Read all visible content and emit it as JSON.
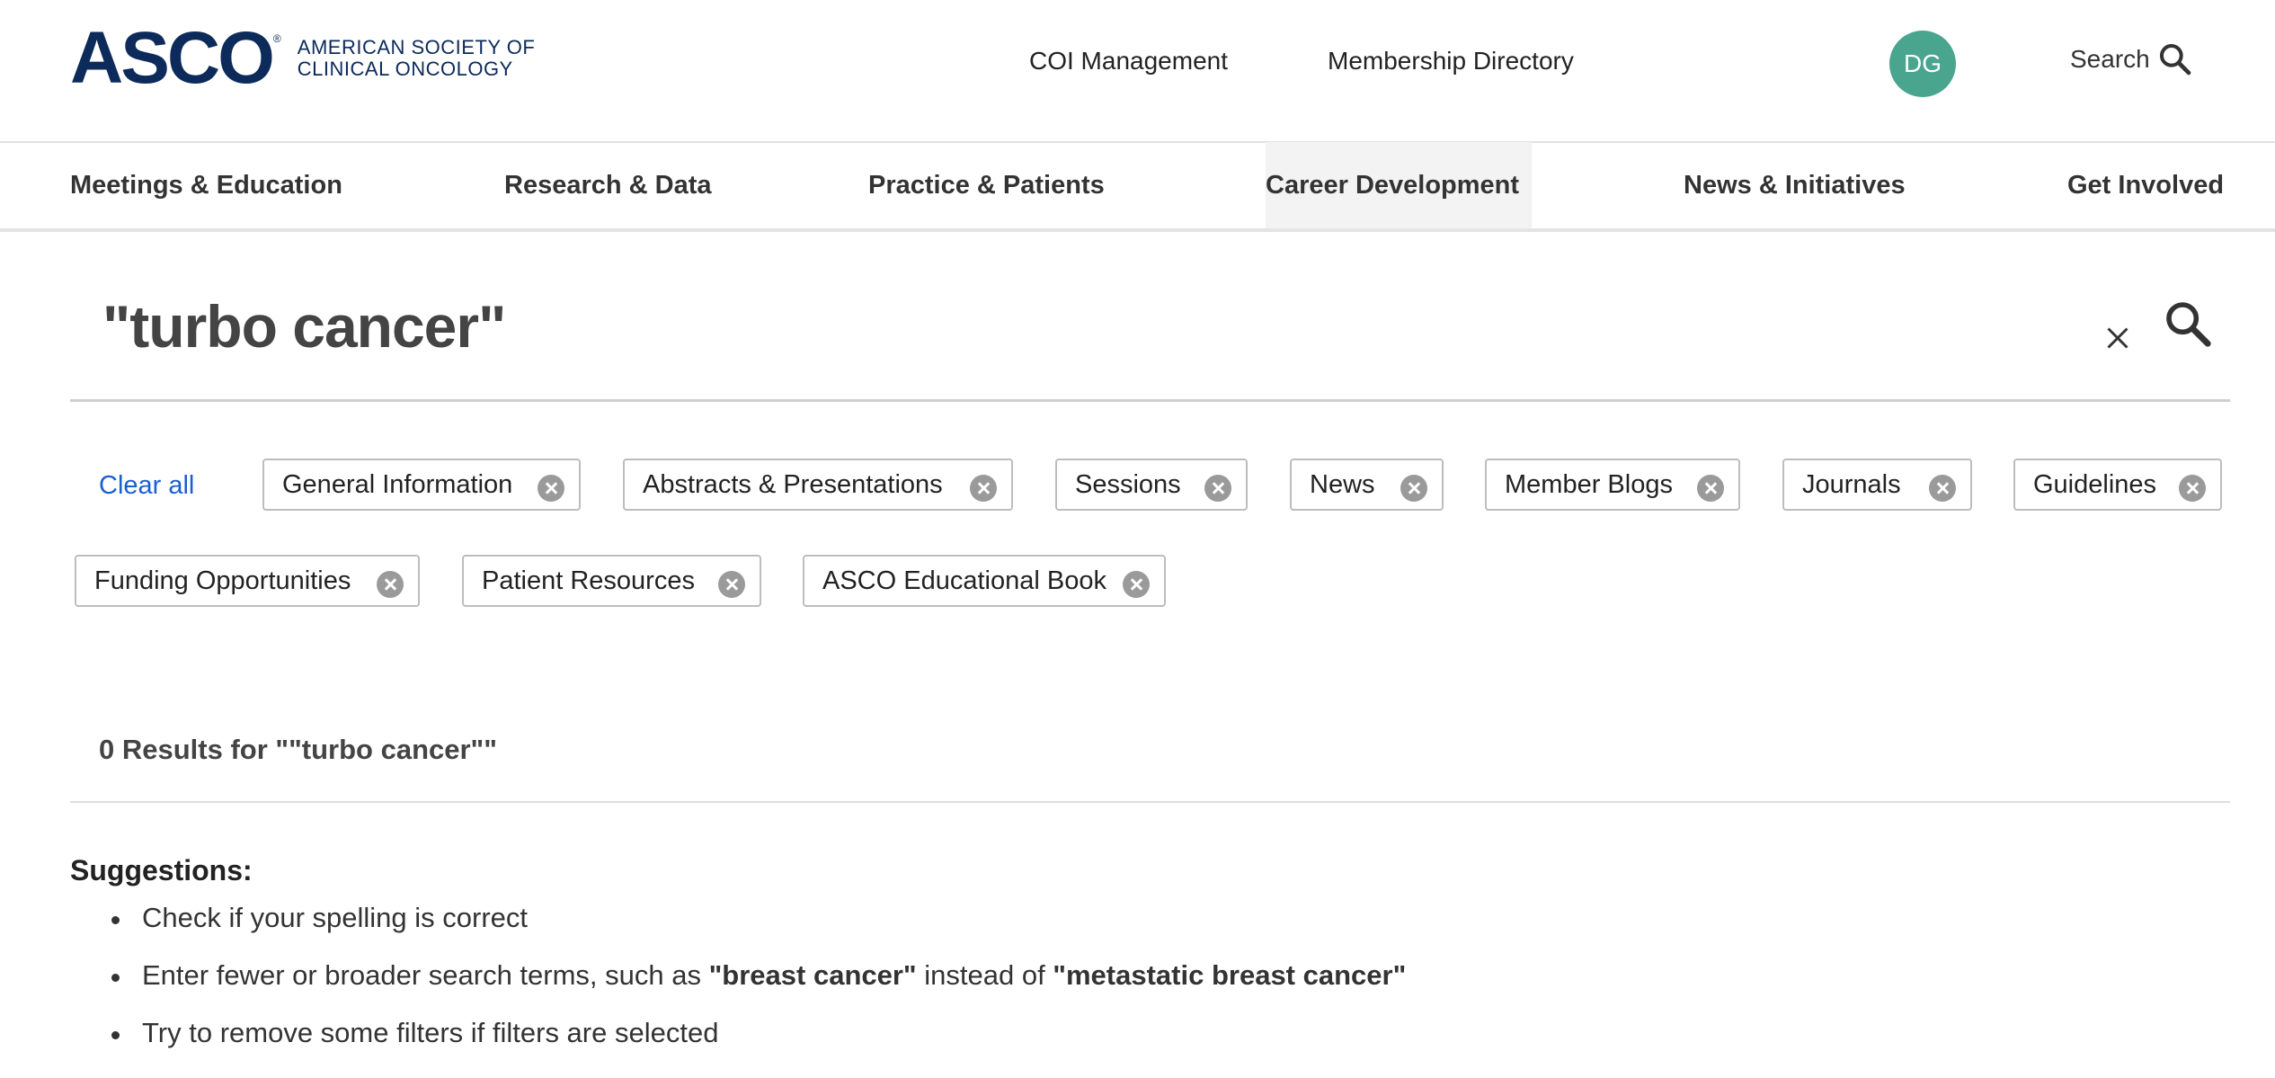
{
  "header": {
    "logo": {
      "mark": "ASCO",
      "reg": "®",
      "line1": "AMERICAN SOCIETY OF",
      "line2": "CLINICAL ONCOLOGY"
    },
    "utility_links": [
      "COI Management",
      "Membership Directory"
    ],
    "avatar_initials": "DG",
    "search_label": "Search"
  },
  "main_nav": [
    "Meetings & Education",
    "Research & Data",
    "Practice & Patients",
    "Career Development",
    "News & Initiatives",
    "Get Involved"
  ],
  "search": {
    "query": "\"turbo cancer\""
  },
  "filters": {
    "clear_all": "Clear all",
    "chips": [
      "General Information",
      "Abstracts & Presentations",
      "Sessions",
      "News",
      "Member Blogs",
      "Journals",
      "Guidelines",
      "Funding Opportunities",
      "Patient Resources",
      "ASCO Educational Book"
    ]
  },
  "results": {
    "count_text": "0 Results for \"\"turbo cancer\"\""
  },
  "suggestions": {
    "title": "Suggestions:",
    "item1": "Check if your spelling is correct",
    "item2_pre": "Enter fewer or broader search terms, such as ",
    "item2_b1": "\"breast cancer\"",
    "item2_mid": " instead of ",
    "item2_b2": "\"metastatic breast cancer\"",
    "item3": "Try to remove some filters if filters are selected"
  },
  "colors": {
    "brand_navy": "#0c2a5a",
    "avatar_green": "#4aa58f",
    "link_blue": "#1a5fd1"
  }
}
